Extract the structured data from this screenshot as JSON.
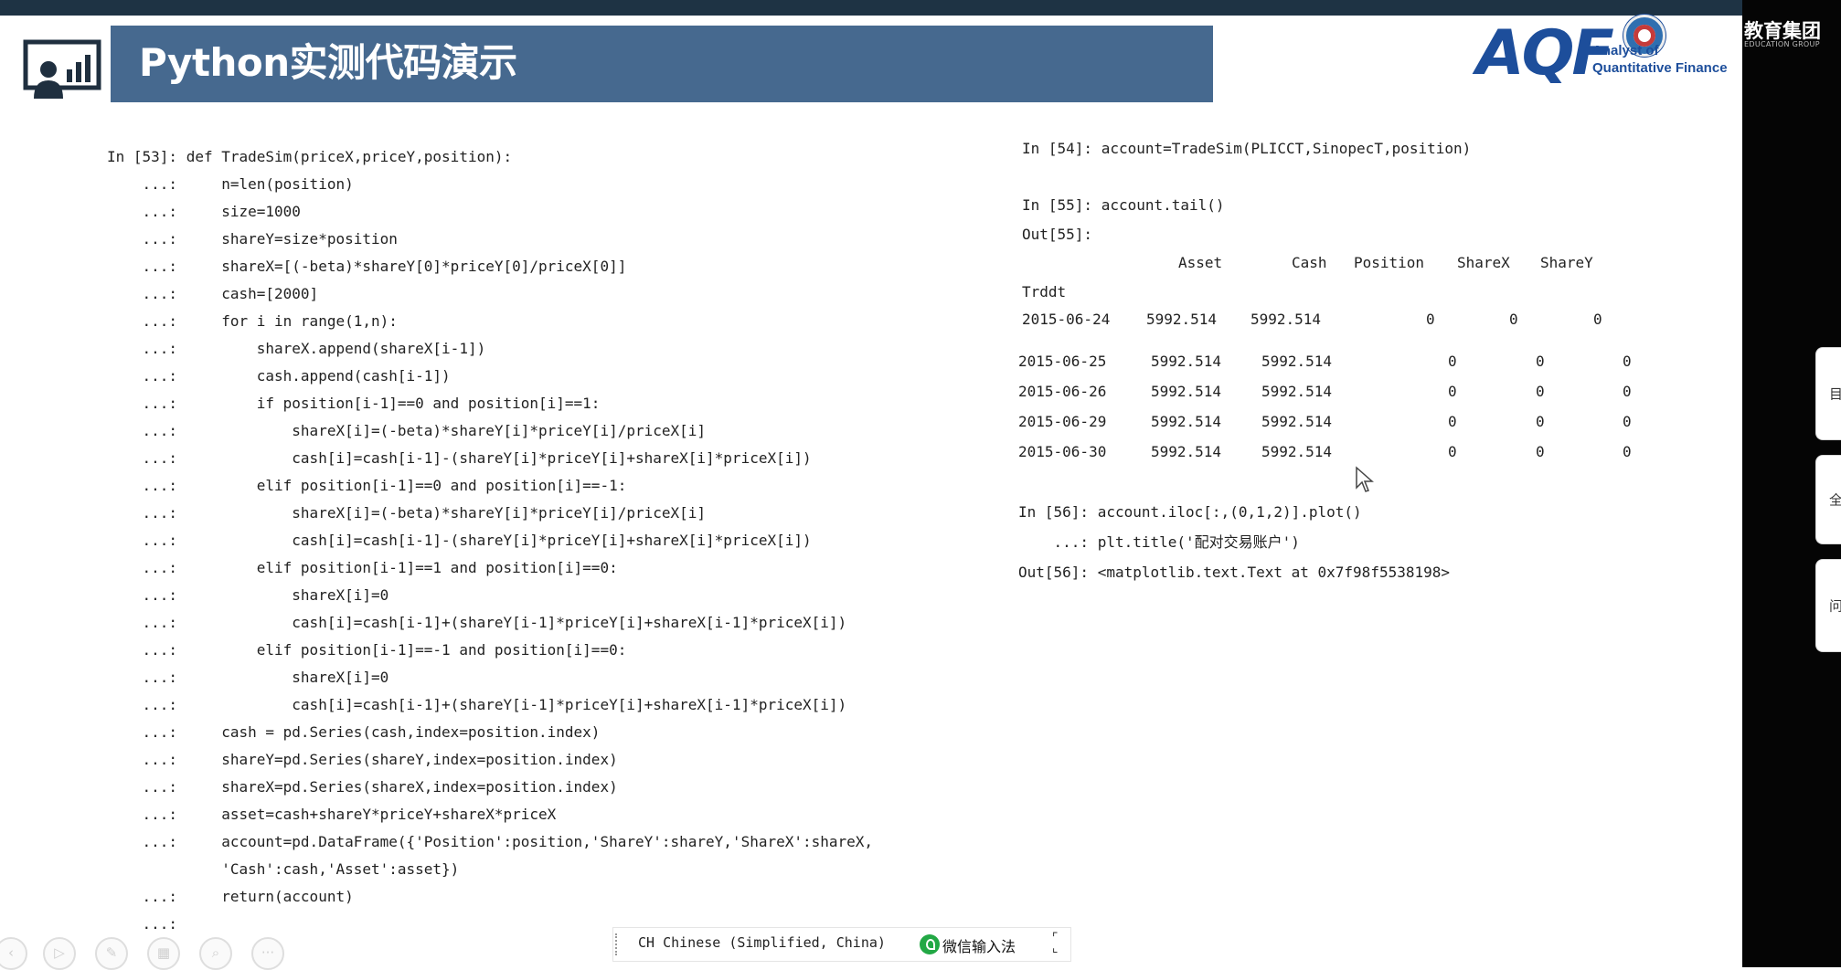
{
  "slide": {
    "title": "Python实测代码演示",
    "logo": {
      "brand": "AQF",
      "line1": "Analyst of",
      "line2": "Quantitative Finance"
    },
    "edu_group_cn": "教育集团",
    "edu_group_en": "EDUCATION GROUP"
  },
  "left_code": [
    "In [53]: def TradeSim(priceX,priceY,position):",
    "    ...:     n=len(position)",
    "    ...:     size=1000",
    "    ...:     shareY=size*position",
    "    ...:     shareX=[(-beta)*shareY[0]*priceY[0]/priceX[0]]",
    "    ...:     cash=[2000]",
    "    ...:     for i in range(1,n):",
    "    ...:         shareX.append(shareX[i-1])",
    "    ...:         cash.append(cash[i-1])",
    "    ...:         if position[i-1]==0 and position[i]==1:",
    "    ...:             shareX[i]=(-beta)*shareY[i]*priceY[i]/priceX[i]",
    "    ...:             cash[i]=cash[i-1]-(shareY[i]*priceY[i]+shareX[i]*priceX[i])",
    "    ...:         elif position[i-1]==0 and position[i]==-1:",
    "    ...:             shareX[i]=(-beta)*shareY[i]*priceY[i]/priceX[i]",
    "    ...:             cash[i]=cash[i-1]-(shareY[i]*priceY[i]+shareX[i]*priceX[i])",
    "    ...:         elif position[i-1]==1 and position[i]==0:",
    "    ...:             shareX[i]=0",
    "    ...:             cash[i]=cash[i-1]+(shareY[i-1]*priceY[i]+shareX[i-1]*priceX[i])",
    "    ...:         elif position[i-1]==-1 and position[i]==0:",
    "    ...:             shareX[i]=0",
    "    ...:             cash[i]=cash[i-1]+(shareY[i-1]*priceY[i]+shareX[i-1]*priceX[i])",
    "    ...:     cash = pd.Series(cash,index=position.index)",
    "    ...:     shareY=pd.Series(shareY,index=position.index)",
    "    ...:     shareX=pd.Series(shareX,index=position.index)",
    "    ...:     asset=cash+shareY*priceY+shareX*priceX",
    "    ...:     account=pd.DataFrame({'Position':position,'ShareY':shareY,'ShareX':shareX,",
    "             'Cash':cash,'Asset':asset})",
    "    ...:     return(account)",
    "    ...:"
  ],
  "right": {
    "in54": "In [54]: account=TradeSim(PLICCT,SinopecT,position)",
    "in55": "In [55]: account.tail()",
    "out55": "Out[55]:",
    "table": {
      "columns": [
        "Asset",
        "Cash",
        "Position",
        "ShareX",
        "ShareY"
      ],
      "index_name": "Trddt",
      "rows": [
        {
          "date": "2015-06-24",
          "cells": [
            "5992.514",
            "5992.514",
            "0",
            "0",
            "0"
          ]
        },
        {
          "date": "2015-06-25",
          "cells": [
            "5992.514",
            "5992.514",
            "0",
            "0",
            "0"
          ]
        },
        {
          "date": "2015-06-26",
          "cells": [
            "5992.514",
            "5992.514",
            "0",
            "0",
            "0"
          ]
        },
        {
          "date": "2015-06-29",
          "cells": [
            "5992.514",
            "5992.514",
            "0",
            "0",
            "0"
          ]
        },
        {
          "date": "2015-06-30",
          "cells": [
            "5992.514",
            "5992.514",
            "0",
            "0",
            "0"
          ]
        }
      ]
    },
    "in56_1": "In [56]: account.iloc[:,(0,1,2)].plot()",
    "in56_2": "    ...: plt.title('配对交易账户')",
    "out56": "Out[56]: <matplotlib.text.Text at 0x7f98f5538198>"
  },
  "ime": {
    "language": "CH Chinese (Simplified, China)",
    "name": "微信输入法"
  },
  "side_tabs": [
    "目",
    "全",
    "问"
  ],
  "presenter_controls": [
    {
      "icon": "back-icon",
      "glyph": "‹"
    },
    {
      "icon": "play-icon",
      "glyph": "▷"
    },
    {
      "icon": "pen-icon",
      "glyph": "✎"
    },
    {
      "icon": "slides-icon",
      "glyph": "▦"
    },
    {
      "icon": "zoom-icon",
      "glyph": "⌕"
    },
    {
      "icon": "more-icon",
      "glyph": "···"
    }
  ]
}
